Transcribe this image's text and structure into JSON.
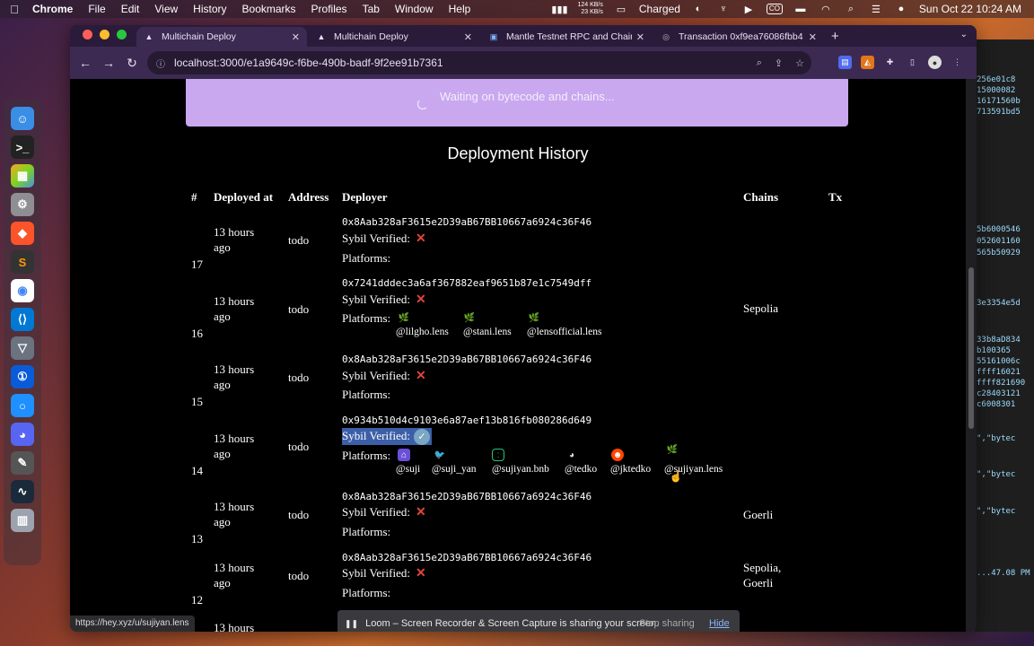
{
  "menubar": {
    "app": "Chrome",
    "items": [
      "File",
      "Edit",
      "View",
      "History",
      "Bookmarks",
      "Profiles",
      "Tab",
      "Window",
      "Help"
    ],
    "net_up": "124 KB/s",
    "net_down": "23 KB/s",
    "battery_label": "Charged",
    "co_label": "CO",
    "datetime": "Sun Oct 22  10:24 AM"
  },
  "tabs": [
    {
      "title": "Multichain Deploy",
      "active": true
    },
    {
      "title": "Multichain Deploy",
      "active": false
    },
    {
      "title": "Mantle Testnet RPC and Chain",
      "active": false
    },
    {
      "title": "Transaction 0xf9ea76086fbb4",
      "active": false
    }
  ],
  "address_bar": {
    "url": "localhost:3000/e1a9649c-f6be-490b-badf-9f2ee91b7361"
  },
  "banner": {
    "text": "Waiting on bytecode and chains..."
  },
  "history": {
    "title": "Deployment History",
    "headers": {
      "num": "#",
      "deployed_at": "Deployed at",
      "address": "Address",
      "deployer": "Deployer",
      "chains": "Chains",
      "tx": "Tx"
    },
    "sybil_label": "Sybil Verified:",
    "platforms_label": "Platforms:",
    "rows": [
      {
        "num": "17",
        "time_line1": "13 hours",
        "time_line2": "ago",
        "address": "todo",
        "deployer": "0x8Aab328aF3615e2D39aB67BB10667a6924c36F46",
        "verified": "✕",
        "chains_line1": "",
        "chains_line2": ""
      },
      {
        "num": "16",
        "time_line1": "13 hours",
        "time_line2": "ago",
        "address": "todo",
        "deployer": "0x7241dddec3a6af367882eaf9651b87e1c7549dff",
        "verified": "✕",
        "chains_line1": "Sepolia",
        "chains_line2": "",
        "handles": [
          "@lilgho.lens",
          "@stani.lens",
          "@lensofficial.lens"
        ]
      },
      {
        "num": "15",
        "time_line1": "13 hours",
        "time_line2": "ago",
        "address": "todo",
        "deployer": "0x8Aab328aF3615e2D39aB67BB10667a6924c36F46",
        "verified": "✕",
        "chains_line1": "",
        "chains_line2": ""
      },
      {
        "num": "14",
        "time_line1": "13 hours",
        "time_line2": "ago",
        "address": "todo",
        "deployer": "0x934b510d4c9103e6a87aef13b816fb080286d649",
        "verified": "✓",
        "chains_line1": "",
        "chains_line2": "",
        "handles": [
          "@suji",
          "@suji_yan",
          "@sujiyan.bnb",
          "@tedko",
          "@jktedko",
          "@sujiyan.lens"
        ]
      },
      {
        "num": "13",
        "time_line1": "13 hours",
        "time_line2": "ago",
        "address": "todo",
        "deployer": "0x8Aab328aF3615e2D39aB67BB10667a6924c36F46",
        "verified": "✕",
        "chains_line1": "Goerli",
        "chains_line2": ""
      },
      {
        "num": "12",
        "time_line1": "13 hours",
        "time_line2": "ago",
        "address": "todo",
        "deployer": "0x8Aab328aF3615e2D39aB67BB10667a6924c36F46",
        "verified": "✕",
        "chains_line1": "Sepolia,",
        "chains_line2": "Goerli"
      },
      {
        "num": "",
        "time_line1": "13 hours",
        "time_line2": "",
        "address": "",
        "deployer": "",
        "verified": "",
        "chains_line1": "",
        "chains_line2": ""
      }
    ]
  },
  "status_url": "https://hey.xyz/u/sujiyan.lens",
  "loom": {
    "message": "Loom – Screen Recorder & Screen Capture is sharing your screen.",
    "stop": "Stop sharing",
    "hide": "Hide"
  },
  "background_window": {
    "lines": [
      "256e01c8",
      "15000082",
      "16171560b",
      "713591bd5",
      "5b6000546",
      "052601160",
      "565b50929",
      "3e3354e5d",
      "33b8aD834",
      "b100365",
      "55161006c",
      "ffff16021",
      "ffff821690",
      "c28403121",
      "c6008301",
      "\",\"bytec",
      "\",\"bytec",
      "\",\"bytec",
      "...47.08 PM"
    ]
  },
  "colors": {
    "banner": "#c9a8f0",
    "toolbar": "#3c2a52",
    "cross": "#e0453a"
  }
}
